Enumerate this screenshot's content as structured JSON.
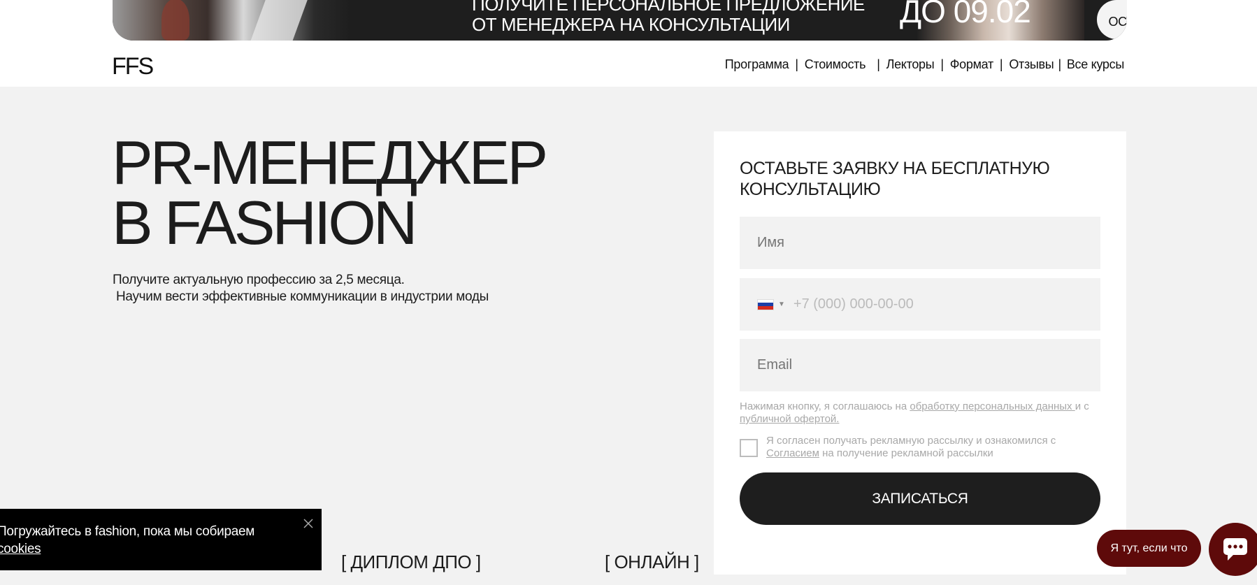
{
  "banner": {
    "line1": "ПОЛУЧИТЕ ПЕРСОНАЛЬНОЕ ПРЕДЛОЖЕНИЕ",
    "line2": "ОТ МЕНЕДЖЕРА НА КОНСУЛЬТАЦИИ",
    "date": "ДО 09.02",
    "button_label": "ОСТАВИТЬ ЗАЯВКУ"
  },
  "header": {
    "logo": "FFS",
    "nav": [
      "Программа",
      "Стоимость",
      "Лекторы",
      "Формат",
      "Отзывы",
      "Все курсы"
    ]
  },
  "hero": {
    "title_line1": "PR-МЕНЕДЖЕР",
    "title_line2": "В FASHION",
    "subtitle_line1": "Получите актуальную профессию за 2,5 месяца.",
    "subtitle_line2": "Научим вести эффективные коммуникации в индустрии моды"
  },
  "tags": [
    "[ ДИПЛОМ ДПО ]",
    "[ ОНЛАЙН ]"
  ],
  "form": {
    "title": "ОСТАВЬТЕ ЗАЯВКУ НА БЕСПЛАТНУЮ КОНСУЛЬТАЦИЮ",
    "name_placeholder": "Имя",
    "phone_placeholder": "+7 (000) 000-00-00",
    "email_placeholder": "Email",
    "consent_prefix": "Нажимая кнопку, я соглашаюсь на ",
    "consent_link1": "обработку персональных данных ",
    "consent_mid": "и с ",
    "consent_link2": "публичной офертой.",
    "checkbox_prefix": "Я согласен получать рекламную рассылку и ознакомился с ",
    "checkbox_link": "Согласием",
    "checkbox_suffix": " на получение рекламной рассылки",
    "submit_label": "ЗАПИСАТЬСЯ"
  },
  "cookie": {
    "text": "Погружайтесь в fashion, пока мы собираем",
    "link": "cookies"
  },
  "chat": {
    "pill_label": "Я тут, если что"
  },
  "colors": {
    "accent_dark": "#1e1e1e",
    "chat_maroon": "#5e0a0a",
    "page_bg": "#f2f2f2"
  }
}
